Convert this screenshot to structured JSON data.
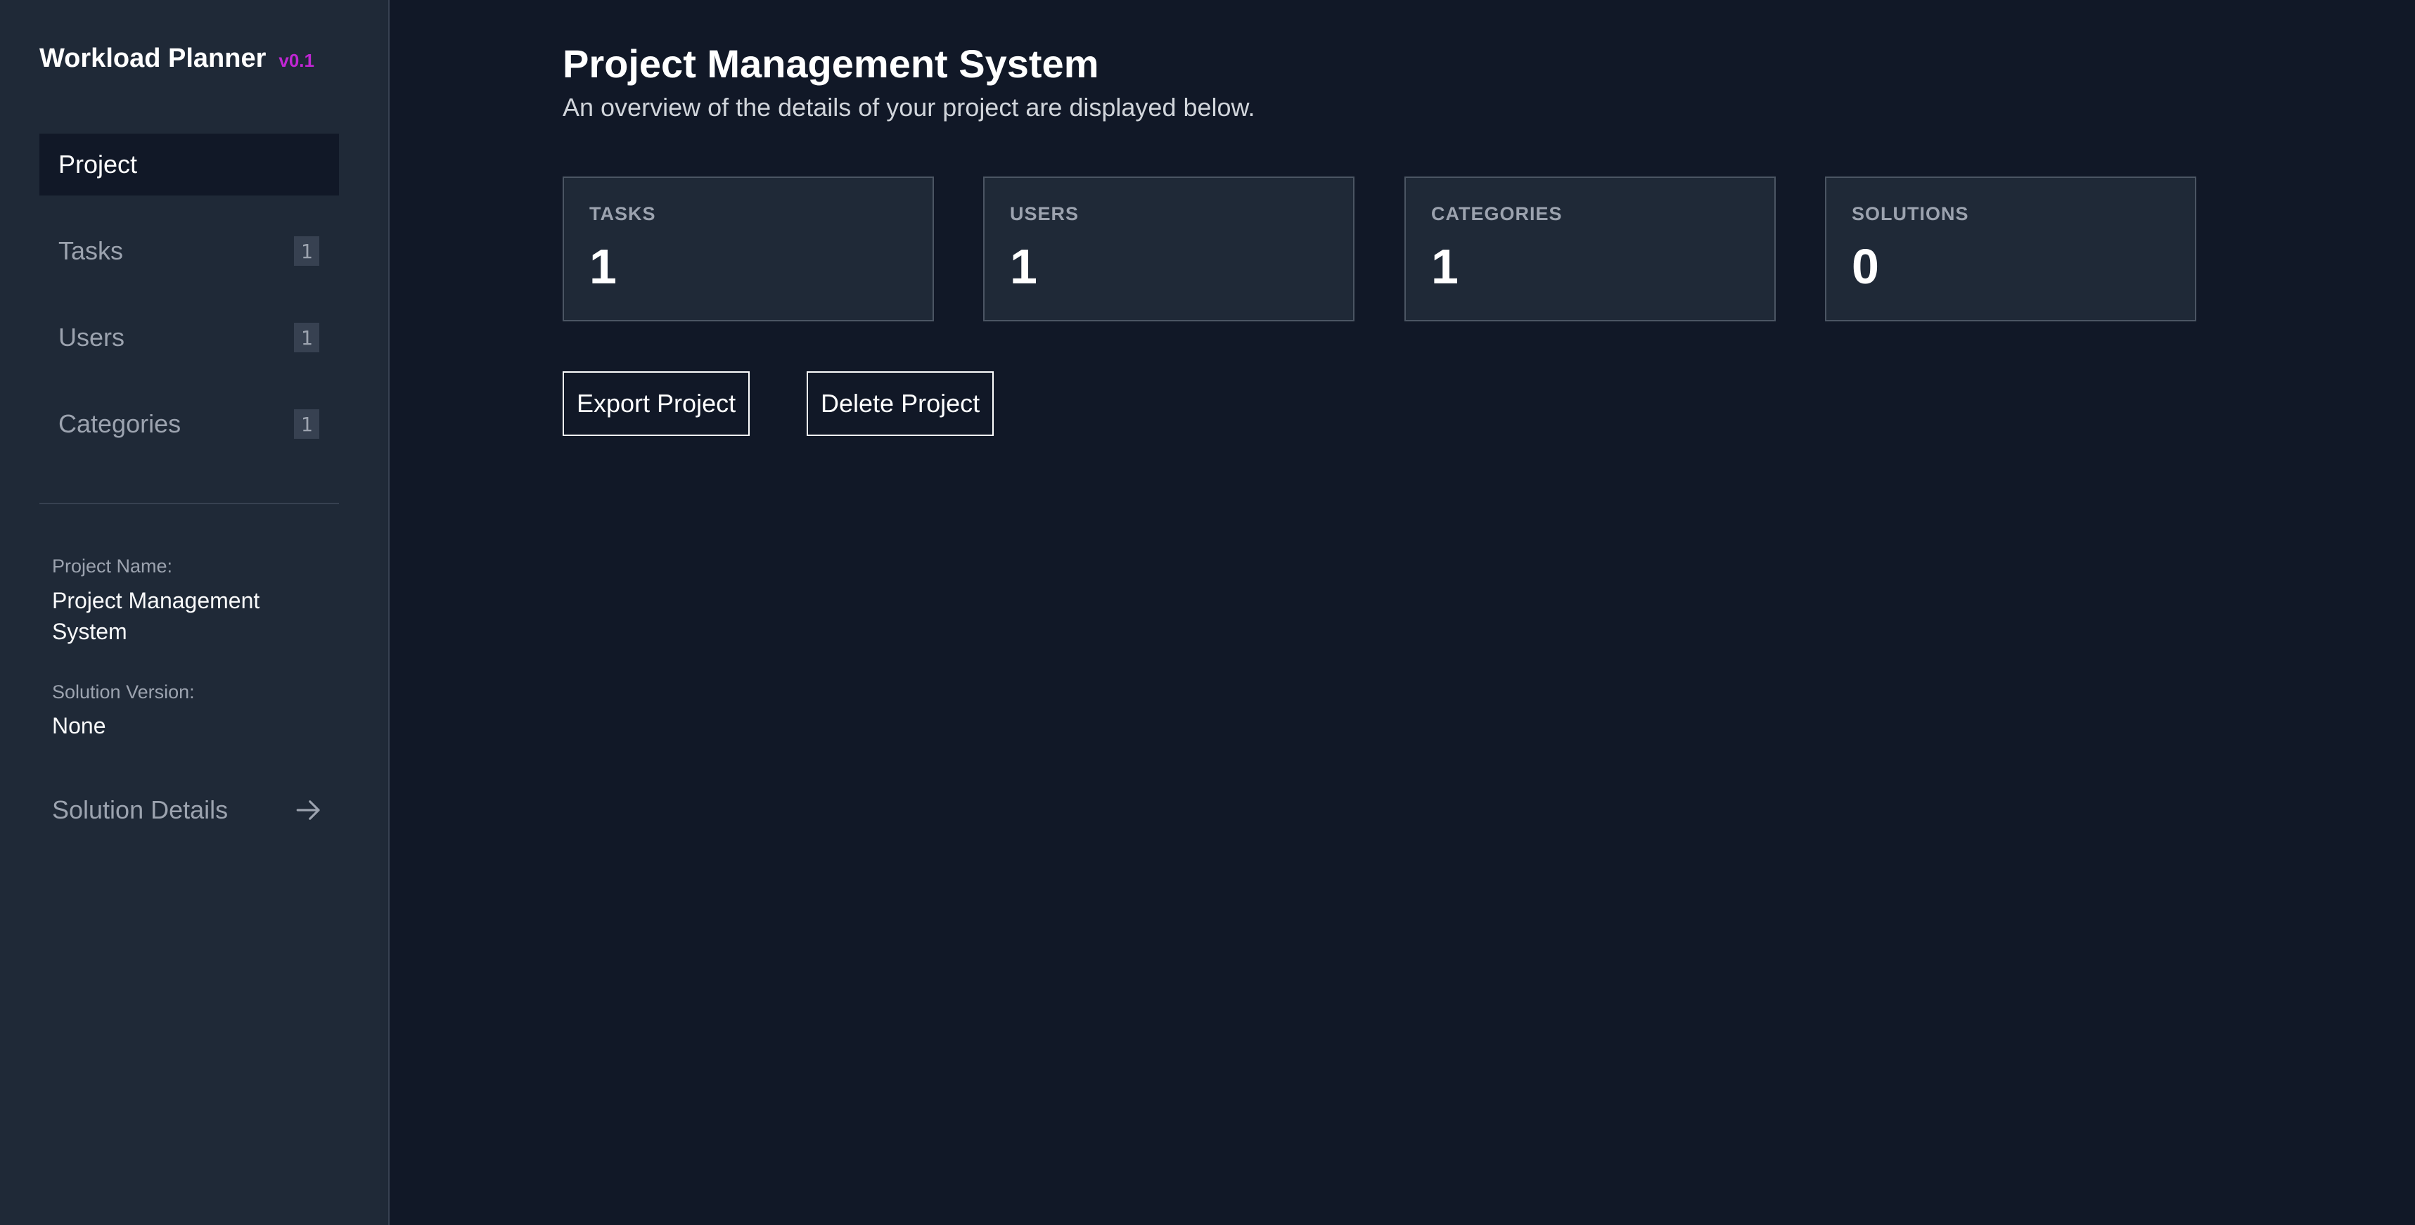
{
  "sidebar": {
    "brand": {
      "title": "Workload Planner",
      "version": "v0.1"
    },
    "nav": [
      {
        "label": "Project",
        "active": true
      },
      {
        "label": "Tasks",
        "badge": "1"
      },
      {
        "label": "Users",
        "badge": "1"
      },
      {
        "label": "Categories",
        "badge": "1"
      }
    ],
    "project_name_label": "Project Name:",
    "project_name_value": "Project Management System",
    "solution_version_label": "Solution Version:",
    "solution_version_value": "None",
    "solution_details_label": "Solution Details",
    "solution_details_icon": "arrow-right-icon"
  },
  "main": {
    "title": "Project Management System",
    "subtitle": "An overview of the details of your project are displayed below.",
    "stats": [
      {
        "label": "TASKS",
        "value": "1"
      },
      {
        "label": "USERS",
        "value": "1"
      },
      {
        "label": "CATEGORIES",
        "value": "1"
      },
      {
        "label": "SOLUTIONS",
        "value": "0"
      }
    ],
    "actions": {
      "export_label": "Export Project",
      "delete_label": "Delete Project"
    }
  },
  "colors": {
    "background": "#111827",
    "sidebar": "#1f2937",
    "accent": "#c026d3",
    "card_border": "#4b5563"
  }
}
